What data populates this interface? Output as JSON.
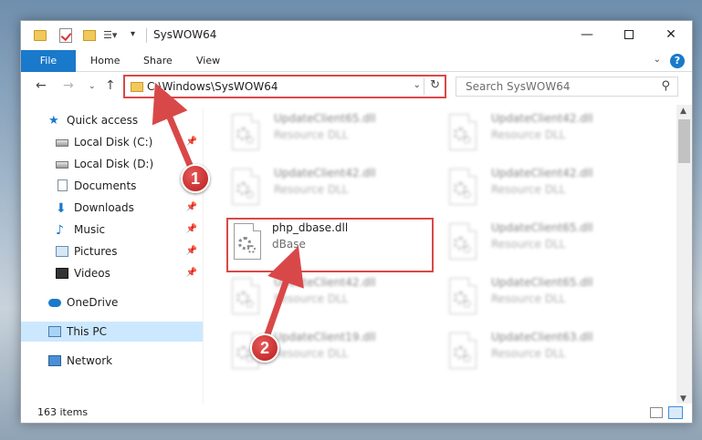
{
  "window": {
    "title": "SysWOW64",
    "minimize": "—",
    "close": "✕"
  },
  "ribbon": {
    "tabs": [
      "File",
      "Home",
      "Share",
      "View"
    ],
    "help": "?"
  },
  "nav": {
    "address": "C:\\Windows\\SysWOW64",
    "search_placeholder": "Search SysWOW64"
  },
  "sidebar": {
    "items": [
      {
        "label": "Quick access",
        "icon": "star-icon",
        "pinned": false
      },
      {
        "label": "Local Disk (C:)",
        "icon": "drive-icon",
        "pinned": true
      },
      {
        "label": "Local Disk (D:)",
        "icon": "drive-icon",
        "pinned": false
      },
      {
        "label": "Documents",
        "icon": "documents-icon",
        "pinned": false
      },
      {
        "label": "Downloads",
        "icon": "download-icon",
        "pinned": true
      },
      {
        "label": "Music",
        "icon": "music-icon",
        "pinned": true
      },
      {
        "label": "Pictures",
        "icon": "pictures-icon",
        "pinned": true
      },
      {
        "label": "Videos",
        "icon": "videos-icon",
        "pinned": true
      },
      {
        "label": "OneDrive",
        "icon": "onedrive-icon",
        "pinned": false
      },
      {
        "label": "This PC",
        "icon": "this-pc-icon",
        "pinned": false,
        "selected": true
      },
      {
        "label": "Network",
        "icon": "network-icon",
        "pinned": false
      }
    ]
  },
  "files": [
    {
      "name": "UpdateClient65.dll",
      "desc": "Resource DLL",
      "blurred": true
    },
    {
      "name": "UpdateClient42.dll",
      "desc": "Resource DLL",
      "blurred": true
    },
    {
      "name": "UpdateClient42.dll",
      "desc": "Resource DLL",
      "blurred": true
    },
    {
      "name": "UpdateClient42.dll",
      "desc": "Resource DLL",
      "blurred": true
    },
    {
      "name": "php_dbase.dll",
      "desc": "dBase",
      "blurred": false,
      "highlighted": true
    },
    {
      "name": "UpdateClient65.dll",
      "desc": "Resource DLL",
      "blurred": true
    },
    {
      "name": "UpdateClient42.dll",
      "desc": "Resource DLL",
      "blurred": true
    },
    {
      "name": "UpdateClient65.dll",
      "desc": "Resource DLL",
      "blurred": true
    },
    {
      "name": "UpdateClient19.dll",
      "desc": "Resource DLL",
      "blurred": true
    },
    {
      "name": "UpdateClient63.dll",
      "desc": "Resource DLL",
      "blurred": true
    }
  ],
  "status": {
    "count": "163 items"
  },
  "annotations": {
    "step1": "1",
    "step2": "2",
    "color": "#d94848"
  }
}
